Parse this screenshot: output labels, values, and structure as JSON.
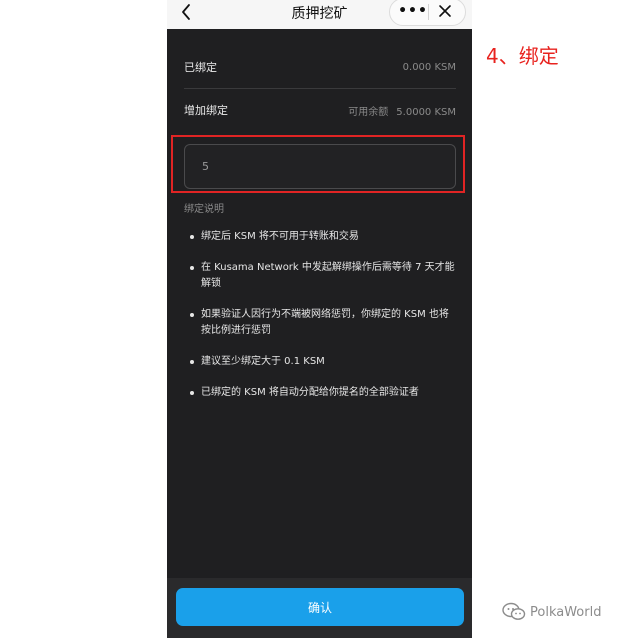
{
  "header": {
    "title": "质押挖矿",
    "more_glyph": "•••"
  },
  "summary": {
    "bonded_label": "已绑定",
    "bonded_value": "0.000 KSM",
    "add_label": "增加绑定",
    "available_label": "可用余额",
    "available_value": "5.0000 KSM"
  },
  "amount_input": {
    "value": "5"
  },
  "notes": {
    "title": "绑定说明",
    "items": [
      "绑定后 KSM 将不可用于转账和交易",
      "在 Kusama Network 中发起解绑操作后需等待 7 天才能解锁",
      "如果验证人因行为不端被网络惩罚，你绑定的 KSM 也将按比例进行惩罚",
      "建议至少绑定大于 0.1 KSM",
      "已绑定的 KSM 将自动分配给你提名的全部验证者"
    ]
  },
  "confirm_label": "确认",
  "annotation": {
    "step": "4、绑定",
    "highlight_color": "#e02424"
  },
  "watermark": {
    "icon": "wechat-icon",
    "text": "PolkaWorld"
  },
  "colors": {
    "background": "#1f1f21",
    "accent": "#1aa0ea"
  }
}
